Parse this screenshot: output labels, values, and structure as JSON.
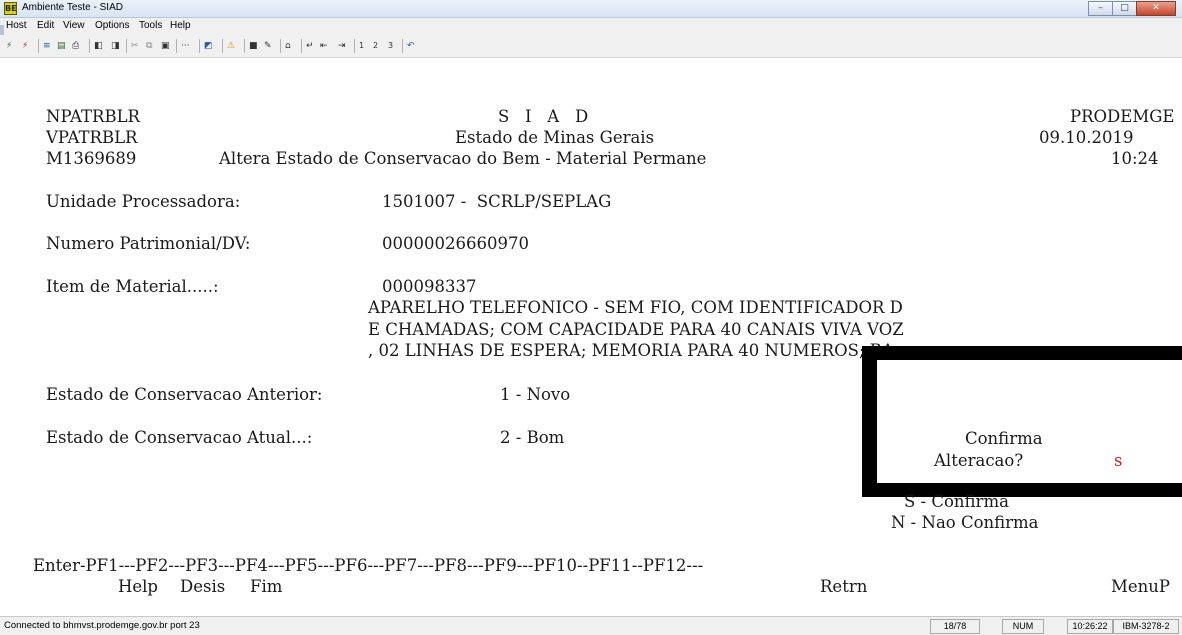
{
  "window": {
    "title": "Ambiente Teste - SIAD",
    "app_icon_text": "BE",
    "min": "–",
    "max": "□",
    "close": "✕"
  },
  "menu": [
    "Host",
    "Edit",
    "View",
    "Options",
    "Tools",
    "Help"
  ],
  "toolbar_icons": [
    "connect-icon",
    "disconnect-icon",
    "send-icon",
    "receive-icon",
    "print-icon",
    "session-icon",
    "session-alt-icon",
    "cut-icon",
    "copy-icon",
    "paste-icon",
    "more-icon",
    "macro-icon",
    "warning-icon",
    "screen-icon",
    "edit-icon",
    "home-icon",
    "enter-icon",
    "field-back-icon",
    "field-forward-icon",
    "pf1-icon",
    "pf2-icon",
    "pf3-icon",
    "undo-icon"
  ],
  "screen": {
    "program1": "NPATRBLR",
    "program2": "VPATRBLR",
    "user_id": "M1369689",
    "system": "S   I   A   D",
    "state": "Estado de Minas Gerais",
    "subtitle": "Altera Estado de Conservacao do Bem - Material Permane",
    "org": "PRODEMGE",
    "date": "09.10.2019",
    "time": "10:24",
    "unidade_label": "Unidade Processadora:",
    "unidade_value": "1501007 -  SCRLP/SEPLAG",
    "numero_label": "Numero Patrimonial/DV:",
    "numero_value": "00000026660970",
    "item_label": "Item de Material.....:",
    "item_code": "000098337",
    "item_desc1": "APARELHO TELEFONICO - SEM FIO, COM IDENTIFICADOR D",
    "item_desc2": "E CHAMADAS; COM CAPACIDADE PARA 40 CANAIS VIVA VOZ",
    "item_desc3": ", 02 LINHAS DE ESPERA; MEMORIA PARA 40 NUMEROS; BA",
    "estado_anterior_label": "Estado de Conservacao Anterior:",
    "estado_anterior_value": "1 - Novo",
    "estado_atual_label": "Estado de Conservacao Atual...:",
    "estado_atual_value": "2 - Bom",
    "pf_line": "Enter-PF1---PF2---PF3---PF4---PF5---PF6---PF7---PF8---PF9---PF10--PF11--PF12---",
    "pf_help": "Help",
    "pf_desis": "Desis",
    "pf_fim": "Fim",
    "pf_retrn": "Retrn",
    "pf_menup": "MenuP"
  },
  "dialog": {
    "line1": "Confirma",
    "line2": "Alteracao?",
    "input_value": "s",
    "opt_s": "S - Confirma",
    "opt_n": "N - Nao Confirma"
  },
  "status": {
    "connection": "Connected to bhmvst.prodemge.gov.br port 23",
    "cursor": "18/78",
    "num": "NUM",
    "clock": "10:26:22",
    "terminal": "IBM-3278-2"
  }
}
